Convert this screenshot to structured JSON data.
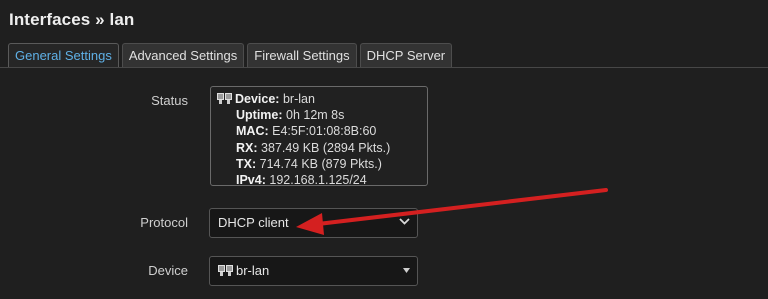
{
  "header": {
    "title": "Interfaces » lan"
  },
  "tabs": [
    {
      "label": "General Settings",
      "active": true
    },
    {
      "label": "Advanced Settings",
      "active": false
    },
    {
      "label": "Firewall Settings",
      "active": false
    },
    {
      "label": "DHCP Server",
      "active": false
    }
  ],
  "status": {
    "label": "Status",
    "icon": "network-port-icon",
    "lines": [
      {
        "key": "Device:",
        "value": "br-lan"
      },
      {
        "key": "Uptime:",
        "value": "0h 12m 8s"
      },
      {
        "key": "MAC:",
        "value": "E4:5F:01:08:8B:60"
      },
      {
        "key": "RX:",
        "value": "387.49 KB (2894 Pkts.)"
      },
      {
        "key": "TX:",
        "value": "714.74 KB (879 Pkts.)"
      },
      {
        "key": "IPv4:",
        "value": "192.168.1.125/24"
      }
    ]
  },
  "protocol": {
    "label": "Protocol",
    "value": "DHCP client",
    "icon": "chevron-down-icon"
  },
  "device": {
    "label": "Device",
    "value": "br-lan",
    "icon": "network-port-icon",
    "dropdown_icon": "caret-down-icon"
  },
  "colors": {
    "background": "#1f1f1f",
    "active_tab": "#5fb0e6",
    "annotation_arrow": "#d42020"
  }
}
